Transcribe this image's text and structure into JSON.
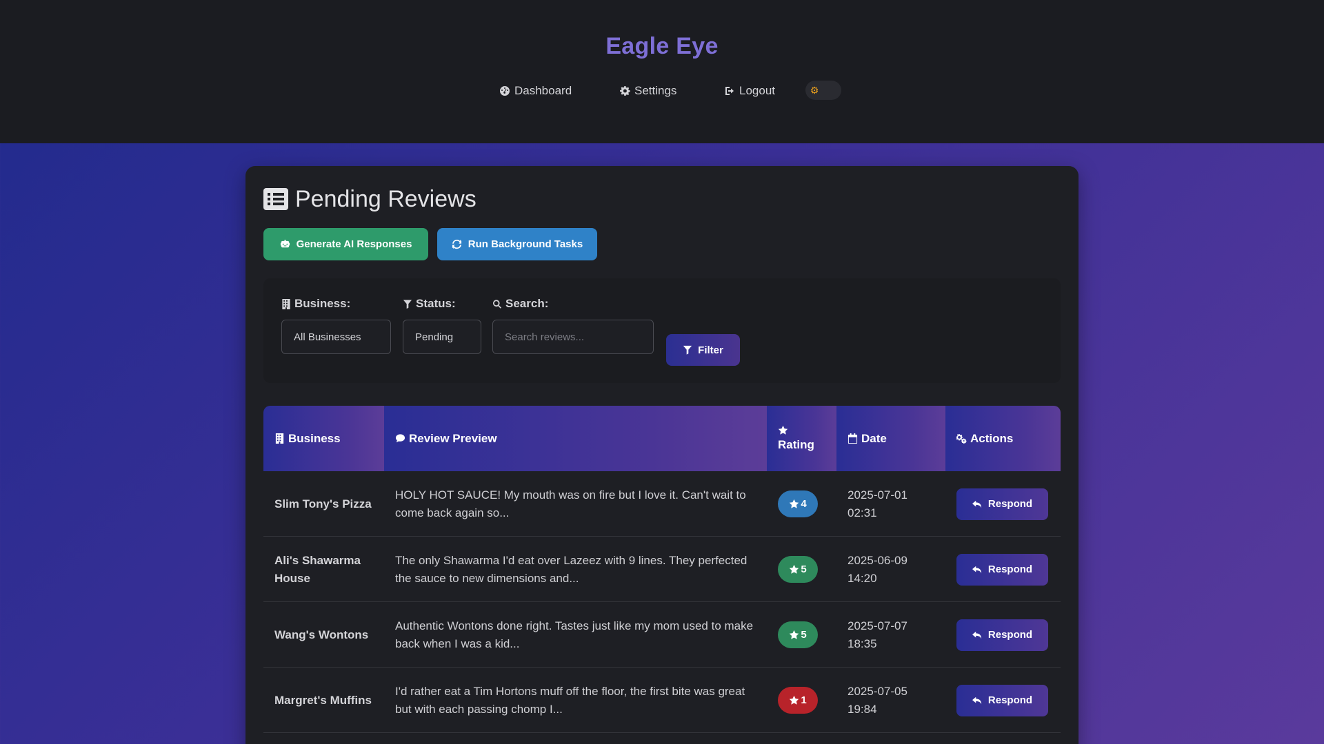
{
  "app": {
    "title": "Eagle Eye"
  },
  "nav": {
    "dashboard": "Dashboard",
    "settings": "Settings",
    "logout": "Logout",
    "theme_icon": "sun-icon"
  },
  "page": {
    "title": "Pending Reviews"
  },
  "actions": {
    "generate": "Generate AI Responses",
    "background": "Run Background Tasks"
  },
  "filters": {
    "business_label": "Business:",
    "business_value": "All Businesses",
    "status_label": "Status:",
    "status_value": "Pending",
    "search_label": "Search:",
    "search_placeholder": "Search reviews...",
    "search_value": "",
    "filter_button": "Filter"
  },
  "table": {
    "headers": {
      "business": "Business",
      "preview": "Review Preview",
      "rating": "Rating",
      "date": "Date",
      "actions": "Actions"
    },
    "rows": [
      {
        "business": "Slim Tony's Pizza",
        "preview": "HOLY HOT SAUCE! My mouth was on fire but I love it. Can't wait to come back again so...",
        "rating": "4",
        "rating_color": "#2f78b8",
        "date": "2025-07-01 02:31",
        "action": "Respond"
      },
      {
        "business": "Ali's Shawarma House",
        "preview": "The only Shawarma I'd eat over Lazeez with 9 lines. They perfected the sauce to new dimensions and...",
        "rating": "5",
        "rating_color": "#2e8a5c",
        "date": "2025-06-09 14:20",
        "action": "Respond"
      },
      {
        "business": "Wang's Wontons",
        "preview": "Authentic Wontons done right. Tastes just like my mom used to make back when I was a kid...",
        "rating": "5",
        "rating_color": "#2e8a5c",
        "date": "2025-07-07 18:35",
        "action": "Respond"
      },
      {
        "business": "Margret's Muffins",
        "preview": "I'd rather eat a Tim Hortons muff off the floor, the first bite was great but with each passing chomp I...",
        "rating": "1",
        "rating_color": "#b8232a",
        "date": "2025-07-05 19:84",
        "action": "Respond"
      }
    ]
  }
}
